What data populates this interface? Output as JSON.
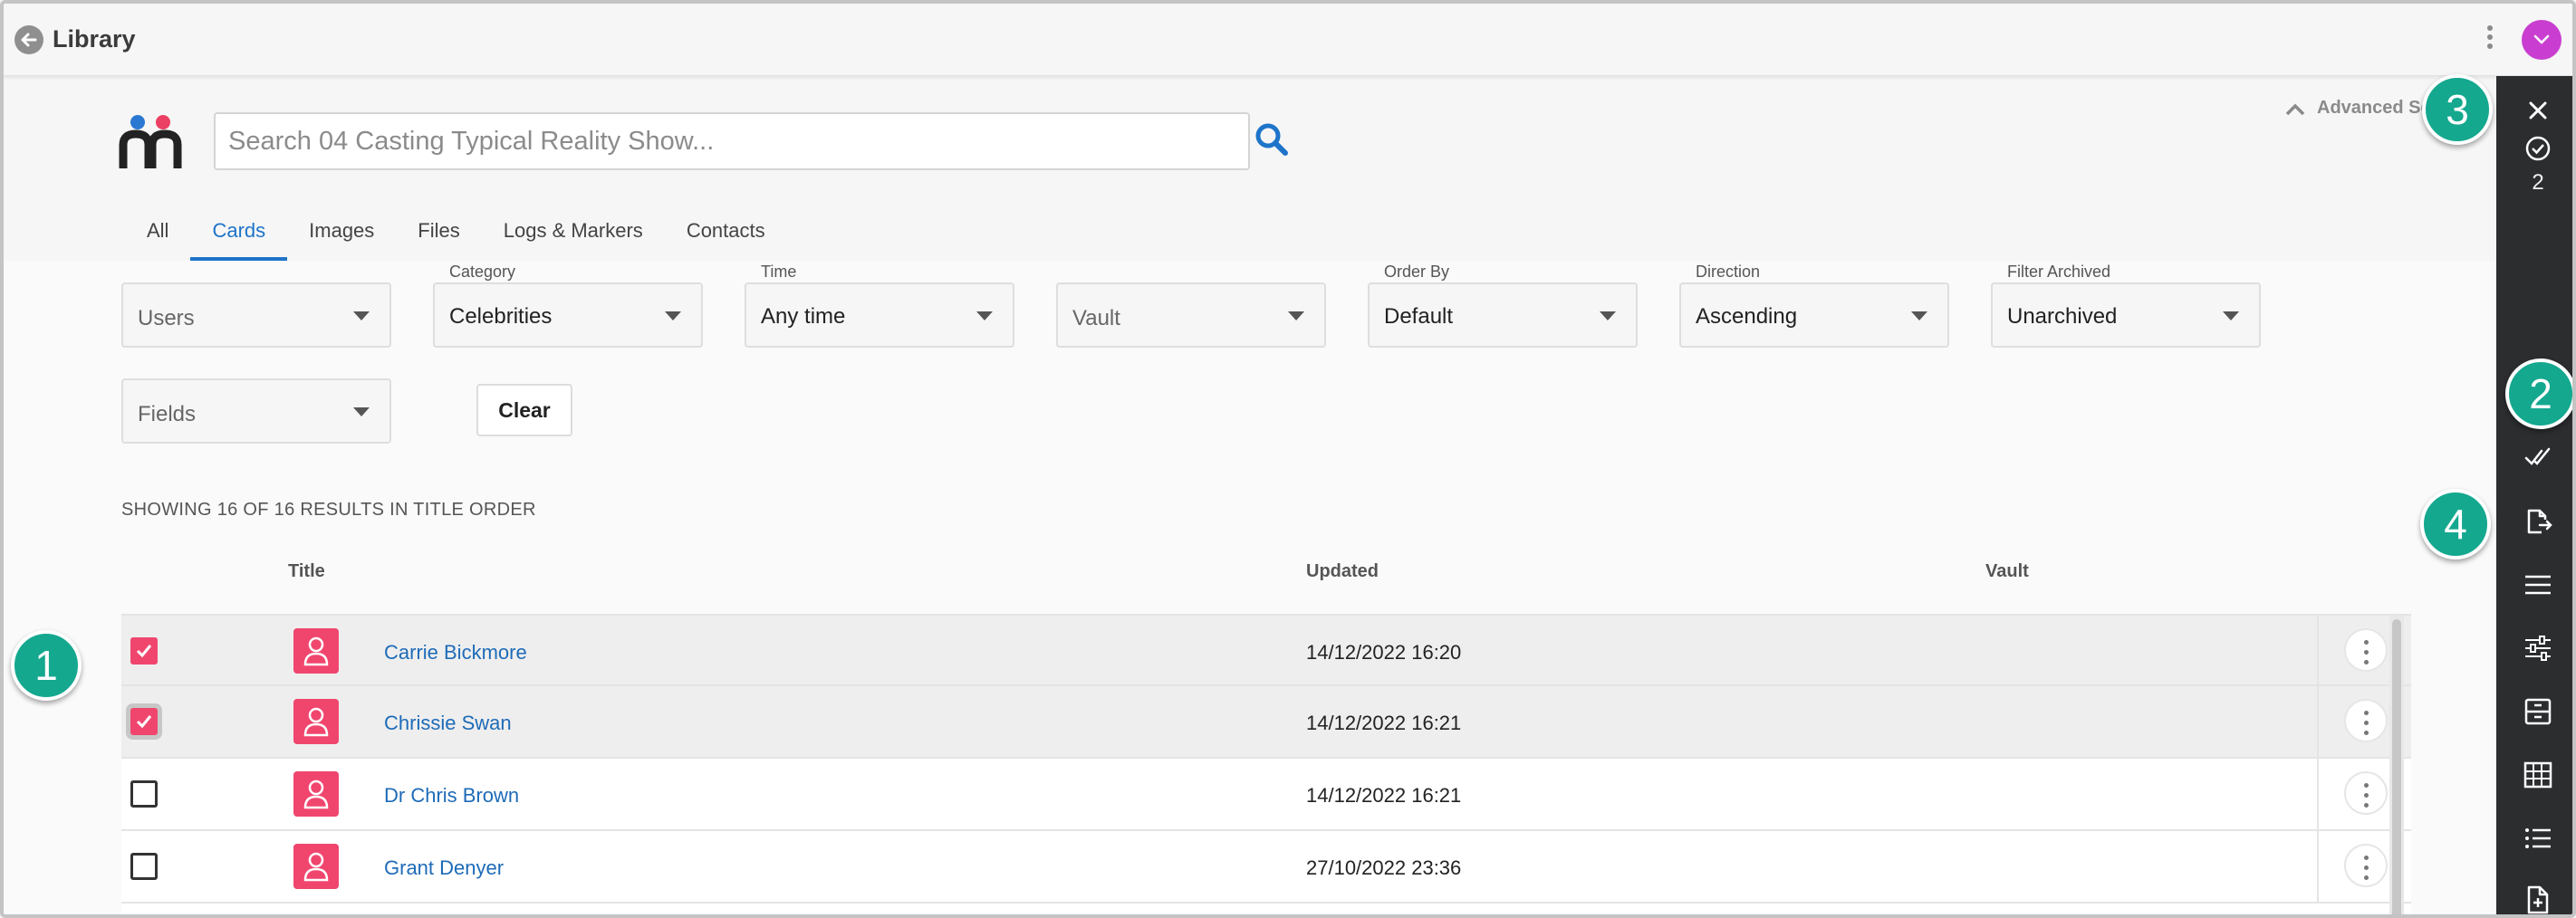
{
  "header": {
    "title": "Library"
  },
  "search": {
    "placeholder": "Search 04 Casting Typical Reality Show...",
    "advanced_label": "Advanced Se"
  },
  "tabs": [
    {
      "label": "All",
      "active": false
    },
    {
      "label": "Cards",
      "active": true
    },
    {
      "label": "Images",
      "active": false
    },
    {
      "label": "Files",
      "active": false
    },
    {
      "label": "Logs & Markers",
      "active": false
    },
    {
      "label": "Contacts",
      "active": false
    }
  ],
  "filters": {
    "users": {
      "label": "",
      "value": "Users"
    },
    "category": {
      "label": "Category",
      "value": "Celebrities"
    },
    "time": {
      "label": "Time",
      "value": "Any time"
    },
    "vault": {
      "label": "",
      "value": "Vault"
    },
    "order_by": {
      "label": "Order By",
      "value": "Default"
    },
    "direction": {
      "label": "Direction",
      "value": "Ascending"
    },
    "filter_archived": {
      "label": "Filter Archived",
      "value": "Unarchived"
    },
    "fields": {
      "label": "",
      "value": "Fields"
    },
    "clear_label": "Clear"
  },
  "results": {
    "summary": "SHOWING 16 OF 16 RESULTS IN TITLE ORDER"
  },
  "table": {
    "columns": {
      "title": "Title",
      "updated": "Updated",
      "vault": "Vault"
    },
    "rows": [
      {
        "title": "Carrie Bickmore",
        "updated": "14/12/2022 16:20",
        "checked": true
      },
      {
        "title": "Chrissie Swan",
        "updated": "14/12/2022 16:21",
        "checked": true
      },
      {
        "title": "Dr Chris Brown",
        "updated": "14/12/2022 16:21",
        "checked": false
      },
      {
        "title": "Grant Denyer",
        "updated": "27/10/2022 23:36",
        "checked": false
      }
    ]
  },
  "toolbar": {
    "selected_count": "2",
    "icons": [
      "close-icon",
      "check-circle-icon",
      "double-check-icon",
      "export-file-icon",
      "menu-lines-icon",
      "sliders-icon",
      "archive-box-icon",
      "grid-table-icon",
      "list-icon",
      "new-file-icon"
    ]
  },
  "callouts": [
    "1",
    "2",
    "3",
    "4"
  ],
  "colors": {
    "accent": "#1e74c9",
    "card_pink": "#f0466e",
    "toolbar_dark": "#2b2d2f",
    "callout_teal": "#14a88f",
    "avatar": "#c93ed0"
  }
}
